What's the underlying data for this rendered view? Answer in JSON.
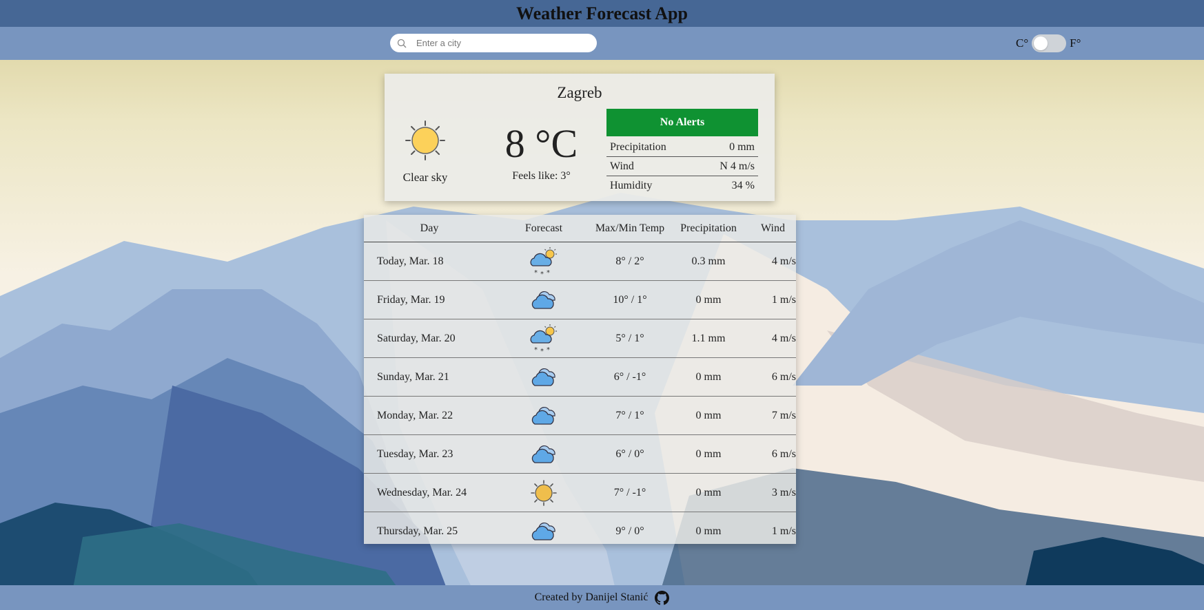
{
  "header": {
    "title": "Weather Forecast App"
  },
  "search": {
    "placeholder": "Enter a city",
    "value": ""
  },
  "units": {
    "celsius_label": "C°",
    "fahrenheit_label": "F°",
    "selected": "C°"
  },
  "current": {
    "city": "Zagreb",
    "icon": "clear-sky-sun-icon",
    "description": "Clear sky",
    "temperature": "8 °C",
    "feels_like": "Feels like: 3°",
    "alerts": "No Alerts",
    "alerts_color": "#0f9232",
    "stats": [
      {
        "label": "Precipitation",
        "value": "0 mm"
      },
      {
        "label": "Wind",
        "value": "N 4 m/s"
      },
      {
        "label": "Humidity",
        "value": "34 %"
      }
    ]
  },
  "forecast": {
    "headers": {
      "day": "Day",
      "forecast": "Forecast",
      "temp": "Max/Min Temp",
      "precipitation": "Precipitation",
      "wind": "Wind"
    },
    "rows": [
      {
        "day": "Today, Mar. 18",
        "icon": "partly-cloudy-snow-icon",
        "temp": "8° / 2°",
        "precipitation": "0.3 mm",
        "wind": "4 m/s"
      },
      {
        "day": "Friday, Mar. 19",
        "icon": "cloudy-icon",
        "temp": "10° / 1°",
        "precipitation": "0 mm",
        "wind": "1 m/s"
      },
      {
        "day": "Saturday, Mar. 20",
        "icon": "partly-cloudy-snow-icon",
        "temp": "5° / 1°",
        "precipitation": "1.1 mm",
        "wind": "4 m/s"
      },
      {
        "day": "Sunday, Mar. 21",
        "icon": "cloudy-icon",
        "temp": "6° / -1°",
        "precipitation": "0 mm",
        "wind": "6 m/s"
      },
      {
        "day": "Monday, Mar. 22",
        "icon": "cloudy-icon",
        "temp": "7° / 1°",
        "precipitation": "0 mm",
        "wind": "7 m/s"
      },
      {
        "day": "Tuesday, Mar. 23",
        "icon": "cloudy-icon",
        "temp": "6° / 0°",
        "precipitation": "0 mm",
        "wind": "6 m/s"
      },
      {
        "day": "Wednesday, Mar. 24",
        "icon": "sun-icon",
        "temp": "7° / -1°",
        "precipitation": "0 mm",
        "wind": "3 m/s"
      },
      {
        "day": "Thursday, Mar. 25",
        "icon": "cloudy-icon",
        "temp": "9° / 0°",
        "precipitation": "0 mm",
        "wind": "1 m/s"
      }
    ]
  },
  "footer": {
    "credit": "Created by Danijel Stanić",
    "link_icon": "github-icon"
  }
}
